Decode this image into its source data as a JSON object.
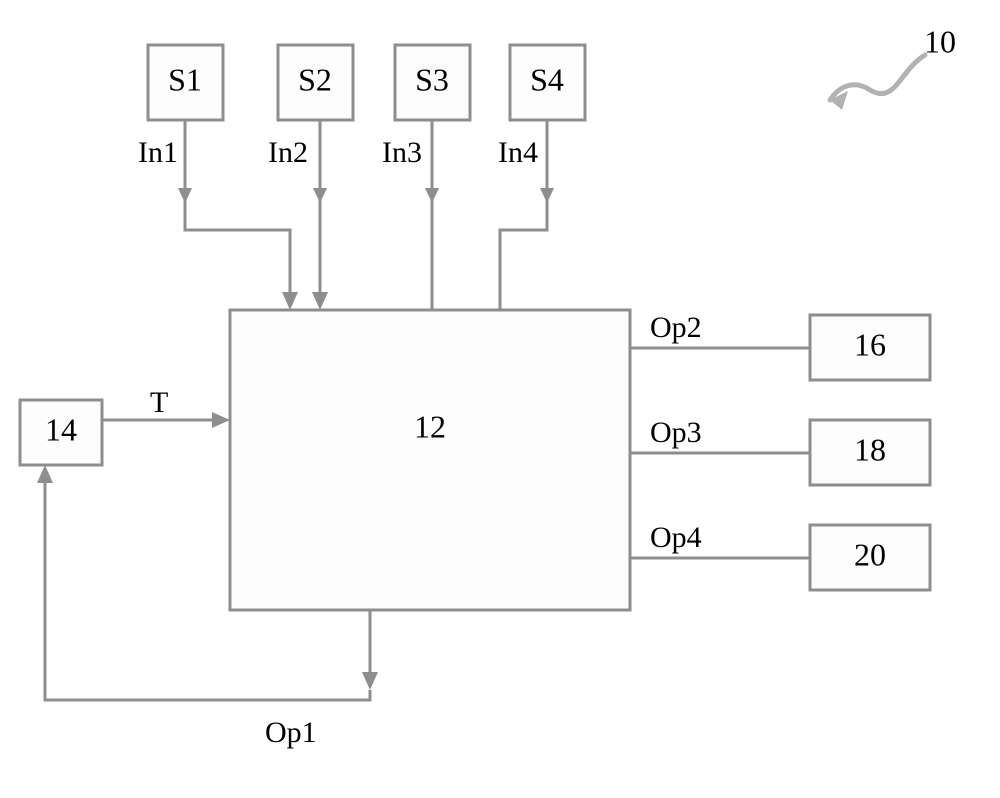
{
  "figure_label": "10",
  "nodes": {
    "s1": "S1",
    "s2": "S2",
    "s3": "S3",
    "s4": "S4",
    "main": "12",
    "left": "14",
    "r1": "16",
    "r2": "18",
    "r3": "20"
  },
  "edges": {
    "in1": "In1",
    "in2": "In2",
    "in3": "In3",
    "in4": "In4",
    "t": "T",
    "op1": "Op1",
    "op2": "Op2",
    "op3": "Op3",
    "op4": "Op4"
  }
}
